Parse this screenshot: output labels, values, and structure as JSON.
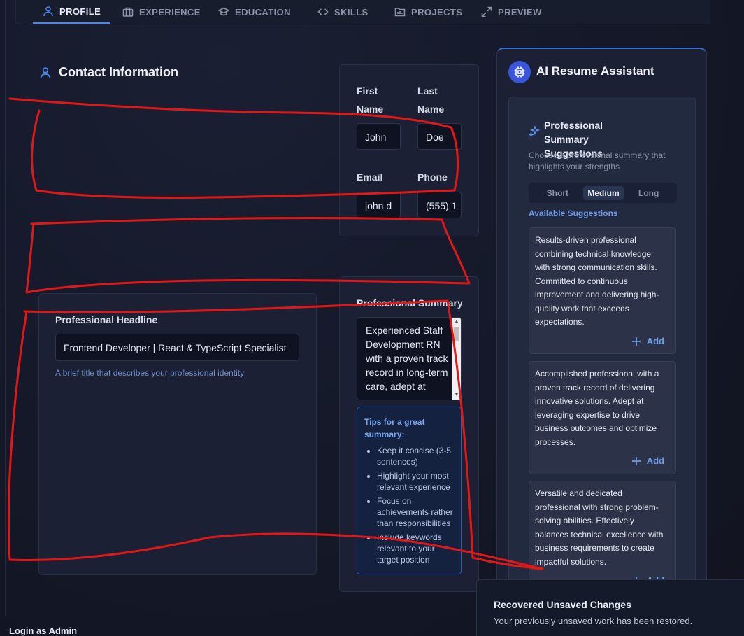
{
  "tabs": [
    {
      "label": "PROFILE",
      "icon": "user-icon",
      "active": true
    },
    {
      "label": "EXPERIENCE",
      "icon": "briefcase-icon",
      "active": false
    },
    {
      "label": "EDUCATION",
      "icon": "graduation-cap-icon",
      "active": false
    },
    {
      "label": "SKILLS",
      "icon": "code-icon",
      "active": false
    },
    {
      "label": "PROJECTS",
      "icon": "folder-icon",
      "active": false
    },
    {
      "label": "PREVIEW",
      "icon": "expand-icon",
      "active": false
    }
  ],
  "contact": {
    "title": "Contact Information",
    "first_name_label_1": "First",
    "first_name_label_2": "Name",
    "last_name_label_1": "Last",
    "last_name_label_2": "Name",
    "first_name_value": "John",
    "last_name_value": "Doe",
    "email_label": "Email",
    "phone_label": "Phone",
    "email_value": "john.d",
    "phone_value": "(555) 1"
  },
  "headline": {
    "label": "Professional Headline",
    "value": "Frontend Developer | React & TypeScript Specialist",
    "help": "A brief title that describes your professional identity"
  },
  "summary": {
    "label": "Professional Summary",
    "value": "Experienced Staff Development RN with a proven track record in long-term care, adept at",
    "tips_title_1": "Tips for a great",
    "tips_title_2": "summary:",
    "tips": [
      "Keep it concise (3-5 sentences)",
      "Highlight your most relevant experience",
      "Focus on achievements rather than responsibilities",
      "Include keywords relevant to your target position"
    ]
  },
  "ai": {
    "title": "AI Resume Assistant",
    "suggestions_title": "Professional Summary Suggestions",
    "suggestions_sub": "Choose a professional summary that highlights your strengths",
    "lengths": [
      "Short",
      "Medium",
      "Long"
    ],
    "active_length": "Medium",
    "available_label": "Available Suggestions",
    "add_label": "Add",
    "suggestions": [
      "Results-driven professional combining technical knowledge with strong communication skills. Committed to continuous improvement and delivering high-quality work that exceeds expectations.",
      "Accomplished professional with a proven track record of delivering innovative solutions. Adept at leveraging expertise to drive business outcomes and optimize processes.",
      "Versatile and dedicated professional with strong problem-solving abilities. Effectively balances technical excellence with business requirements to create impactful solutions."
    ]
  },
  "toast": {
    "title": "Recovered Unsaved Changes",
    "body": "Your previously unsaved work has been restored."
  },
  "footer": {
    "login_admin": "Login as Admin"
  },
  "colors": {
    "accent": "#4a86f0",
    "annotation": "#e01818",
    "background": "#141828"
  }
}
